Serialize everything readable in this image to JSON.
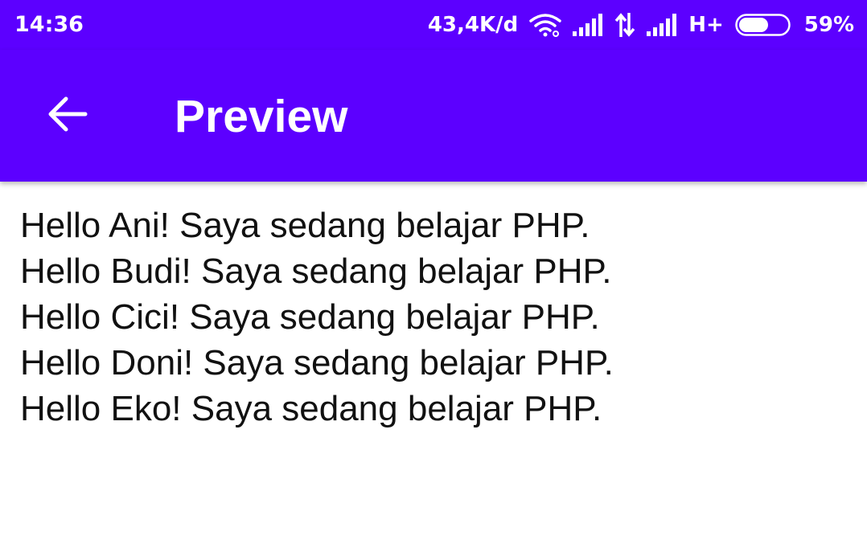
{
  "status_bar": {
    "time": "14:36",
    "network_speed": "43,4K/d",
    "network_type": "H+",
    "battery_percent": "59%",
    "battery_level": 0.59,
    "icons": [
      "wifi-icon",
      "signal-icon",
      "data-arrows-icon",
      "signal-icon",
      "battery-icon"
    ]
  },
  "app_bar": {
    "title": "Preview",
    "back_icon": "arrow-back-icon"
  },
  "content": {
    "lines": [
      "Hello Ani! Saya sedang belajar PHP.",
      "Hello Budi! Saya sedang belajar PHP.",
      "Hello Cici! Saya sedang belajar PHP.",
      "Hello Doni! Saya sedang belajar PHP.",
      "Hello Eko! Saya sedang belajar PHP."
    ]
  },
  "colors": {
    "primary": "#5c00ff",
    "on_primary": "#ffffff",
    "text": "#111111",
    "background": "#ffffff"
  }
}
